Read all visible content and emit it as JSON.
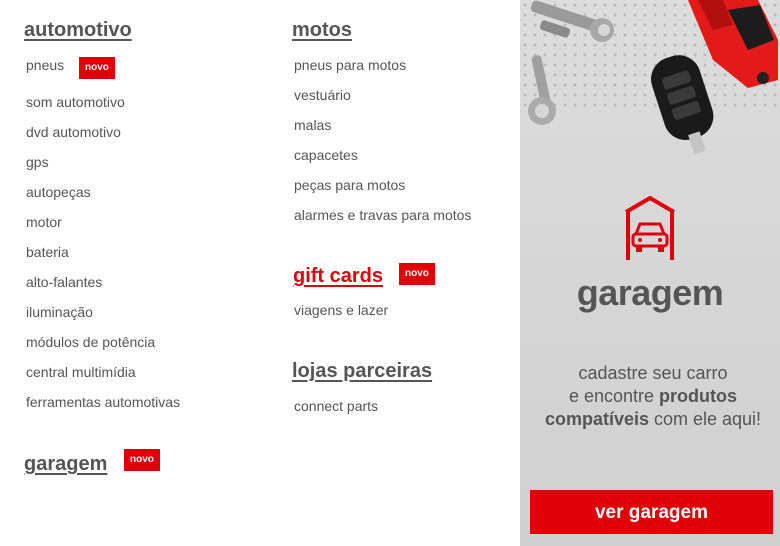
{
  "automotivo": {
    "heading": "automotivo",
    "items": [
      "pneus",
      "som automotivo",
      "dvd automotivo",
      "gps",
      "autopeças",
      "motor",
      "bateria",
      "alto-falantes",
      "iluminação",
      "módulos de potência",
      "central multimídia",
      "ferramentas automotivas"
    ],
    "pneus_badge": "novo"
  },
  "garagem_section": {
    "heading": "garagem",
    "badge": "novo"
  },
  "motos": {
    "heading": "motos",
    "items": [
      "pneus para motos",
      "vestuário",
      "malas",
      "capacetes",
      "peças para motos",
      "alarmes e travas para motos"
    ]
  },
  "gift_cards": {
    "heading": "gift cards",
    "badge": "novo",
    "items": [
      "viagens e lazer"
    ]
  },
  "lojas_parceiras": {
    "heading": "lojas parceiras",
    "items": [
      "connect parts"
    ]
  },
  "banner": {
    "logo_text": "garagem",
    "copy_line1": "cadastre seu carro",
    "copy_line2_a": "e encontre ",
    "copy_line2_b": "produtos",
    "copy_line3_a": "compatíveis",
    "copy_line3_b": " com ele aqui!",
    "cta_label": "ver garagem"
  },
  "colors": {
    "accent": "#e00008",
    "text": "#555555"
  },
  "icons": [
    "car-garage-icon",
    "wrench-icon",
    "car-key-icon",
    "red-car-icon"
  ]
}
